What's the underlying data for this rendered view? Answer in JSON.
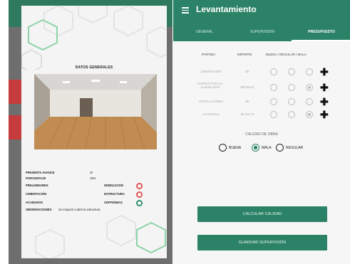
{
  "left": {
    "card_title": "DATOS GENERALES",
    "info": {
      "presenta_avance_label": "PRESENTA AVANCE",
      "presenta_avance_value": "SI",
      "porcentaje_label": "PORCENTAJE",
      "porcentaje_value": "15%",
      "preliminares_label": "PRELIMINARES",
      "demolicion_label": "DEMOLICIÓN",
      "cimentacion_label": "CIMENTACIÓN",
      "estructura_label": "ESTRUCTURA",
      "acabados_label": "ACABADOS",
      "soffidimas_label": "SOFFIDIMAS",
      "observaciones_label": "OBSERVACIONES",
      "observaciones_value": "Se empezó a abrir la estructura"
    }
  },
  "right": {
    "title": "Levantamiento",
    "tabs": [
      "GENERAL",
      "SUPERVISIÓN",
      "PRESUPUESTO"
    ],
    "active_tab": "PRESUPUESTO",
    "headers": {
      "partida": "PARTIDA",
      "importe": "IMPORTE",
      "calidad": "BUENA / REGULAR / MALA"
    },
    "rows": [
      {
        "partida": "CIMENTACIÓN",
        "importe": "$0"
      },
      {
        "partida": "ESTRUCTURA y/o ALBAÑILERÍA",
        "importe": "$69,553.6"
      },
      {
        "partida": "INSTALACIONES",
        "importe": "$0"
      },
      {
        "partida": "ACABADOS",
        "importe": "$5,212.76"
      }
    ],
    "calidad_obra_title": "CALIDAD DE OBRA",
    "options": [
      "BUENA",
      "MALA",
      "REGULAR"
    ],
    "selected_option": "MALA",
    "calcular_button": "CALCULAR CALIDAD",
    "guardar_button": "GUARDAR SUPERVISIÓN"
  }
}
